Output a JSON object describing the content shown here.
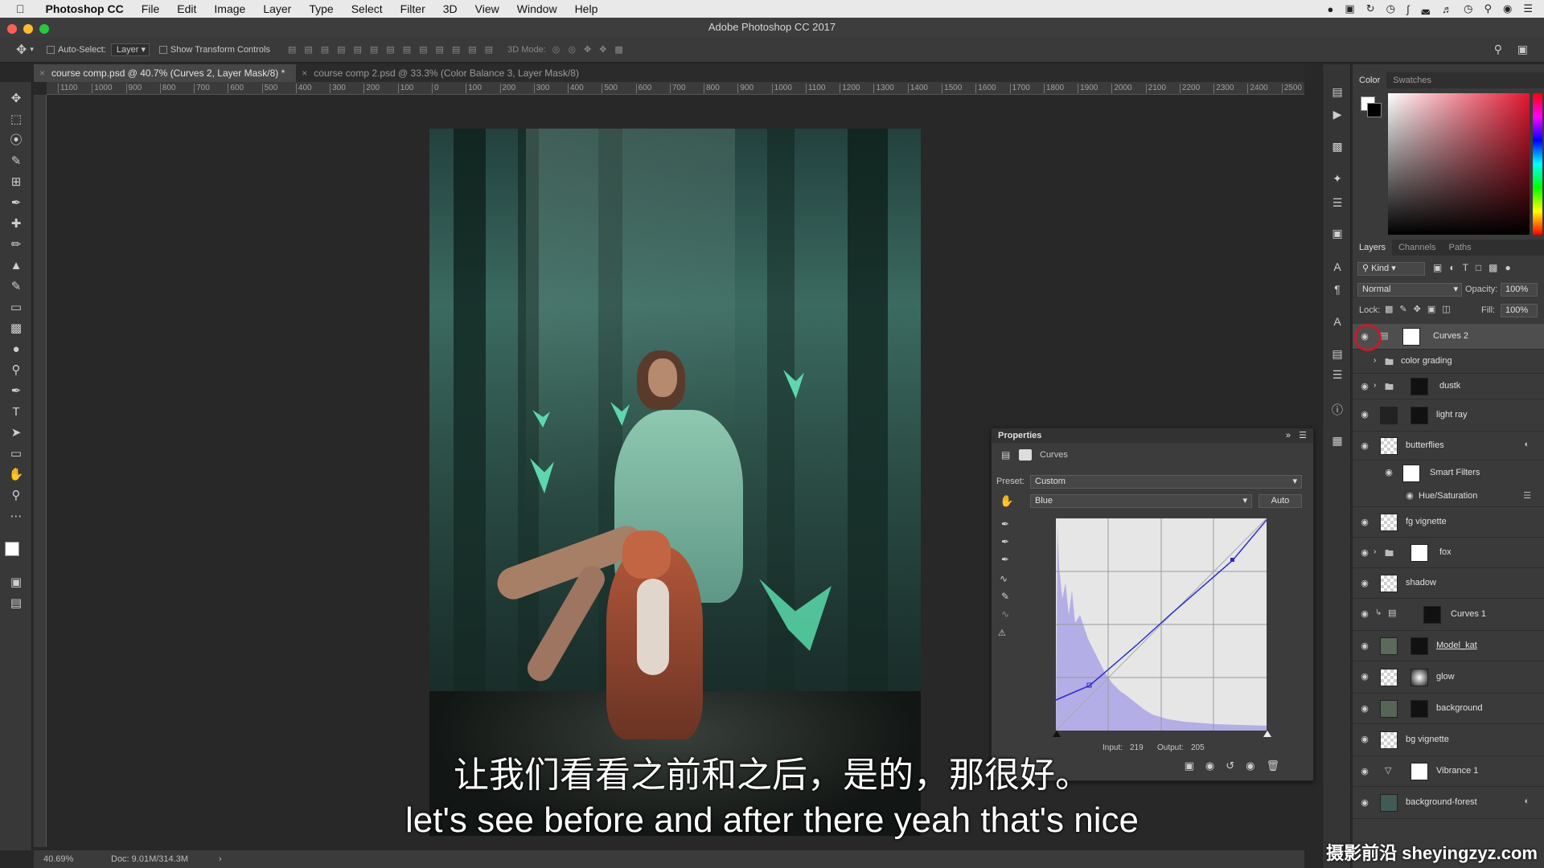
{
  "menubar": {
    "app_name": "Photoshop CC",
    "items": [
      "File",
      "Edit",
      "Image",
      "Layer",
      "Type",
      "Select",
      "Filter",
      "3D",
      "View",
      "Window",
      "Help"
    ]
  },
  "window": {
    "title": "Adobe Photoshop CC 2017"
  },
  "options": {
    "auto_select_label": "Auto-Select:",
    "auto_select_value": "Layer",
    "transform_label": "Show Transform Controls",
    "mode_3d": "3D Mode:"
  },
  "tabs": [
    {
      "label": "course comp.psd @ 40.7% (Curves 2, Layer Mask/8) *"
    },
    {
      "label": "course comp 2.psd @ 33.3% (Color Balance 3, Layer Mask/8)"
    }
  ],
  "ruler_ticks": [
    "1100",
    "1000",
    "900",
    "800",
    "700",
    "600",
    "500",
    "400",
    "300",
    "200",
    "100",
    "0",
    "100",
    "200",
    "300",
    "400",
    "500",
    "600",
    "700",
    "800",
    "900",
    "1000",
    "1100",
    "1200",
    "1300",
    "1400",
    "1500",
    "1600",
    "1700",
    "1800",
    "1900",
    "2000",
    "2100",
    "2200",
    "2300",
    "2400",
    "2500"
  ],
  "status": {
    "zoom": "40.69%",
    "doc": "Doc: 9.01M/314.3M"
  },
  "color_panel": {
    "tab_color": "Color",
    "tab_swatches": "Swatches"
  },
  "layers_panel": {
    "tabs": [
      "Layers",
      "Channels",
      "Paths"
    ],
    "kind": "Kind",
    "blend": "Normal",
    "opacity_label": "Opacity:",
    "opacity": "100%",
    "lock_label": "Lock:",
    "fill_label": "Fill:",
    "fill": "100%",
    "layers": [
      {
        "name": "Curves 2"
      },
      {
        "name": "color grading"
      },
      {
        "name": "dustk"
      },
      {
        "name": "light ray"
      },
      {
        "name": "butterflies"
      },
      {
        "name": "Smart Filters"
      },
      {
        "name": "Hue/Saturation"
      },
      {
        "name": "fg vignette"
      },
      {
        "name": "fox"
      },
      {
        "name": "shadow"
      },
      {
        "name": "Curves 1"
      },
      {
        "name": "Model_kat"
      },
      {
        "name": "glow"
      },
      {
        "name": "background"
      },
      {
        "name": "bg vignette"
      },
      {
        "name": "Vibrance 1"
      },
      {
        "name": "background-forest"
      }
    ]
  },
  "properties": {
    "title": "Properties",
    "type_label": "Curves",
    "preset_label": "Preset:",
    "preset_value": "Custom",
    "channel": "Blue",
    "auto_label": "Auto",
    "input_label": "Input:",
    "input_value": "219",
    "output_label": "Output:",
    "output_value": "205"
  },
  "subtitles": {
    "cn": "让我们看看之前和之后，是的，那很好。",
    "en": "let's see before and after there yeah that's nice"
  },
  "watermark": "摄影前沿 sheyingzyz.com"
}
